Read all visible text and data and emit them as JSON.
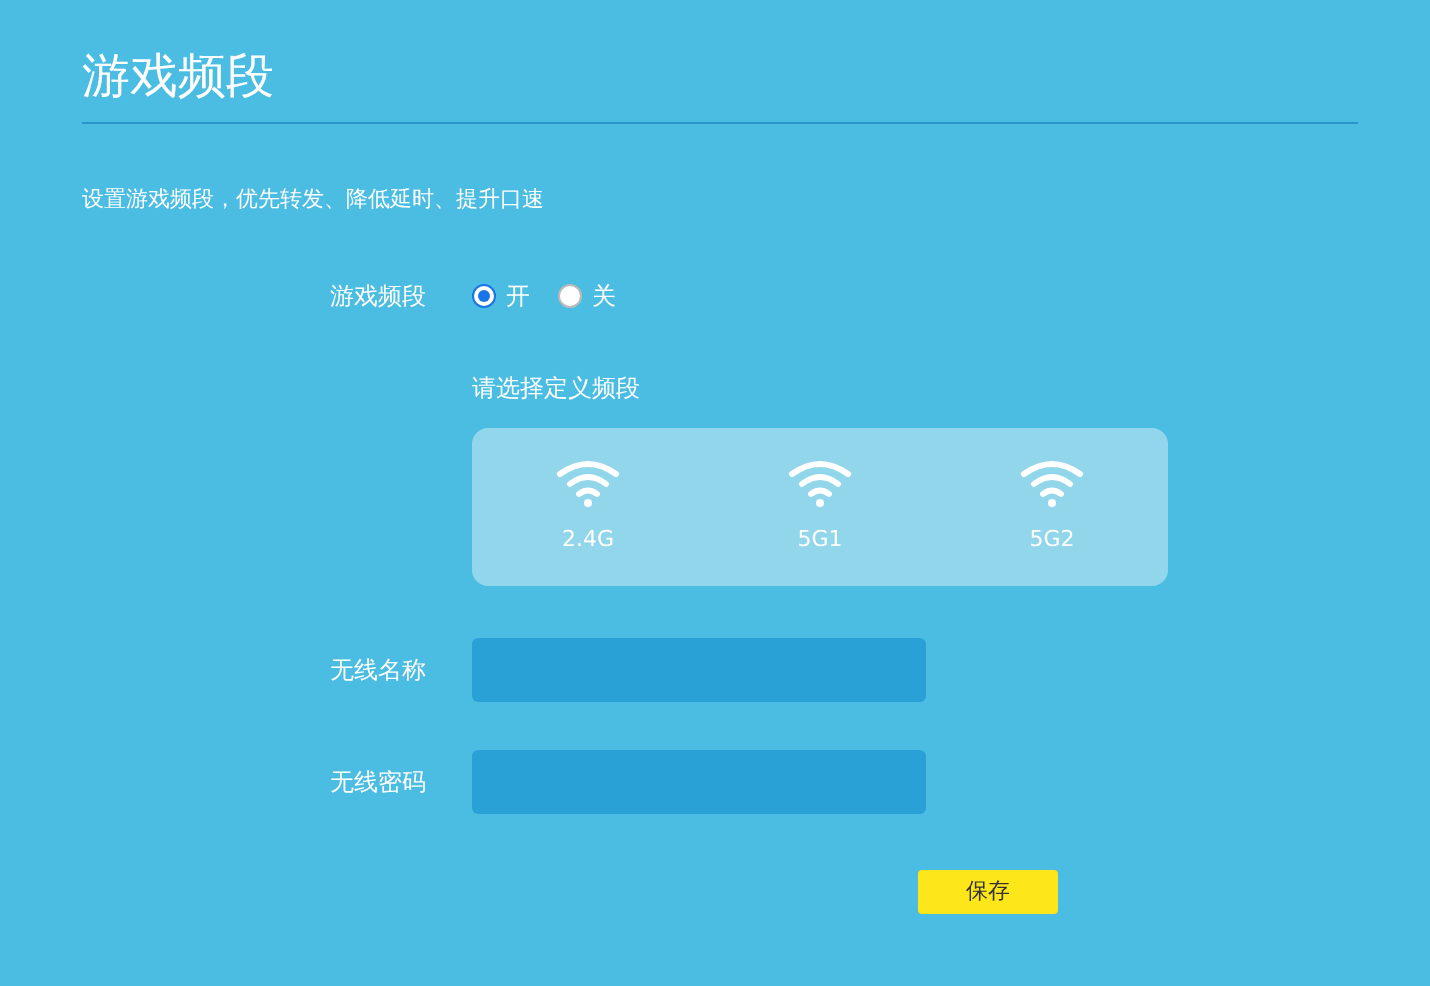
{
  "title": "游戏频段",
  "description": "设置游戏频段，优先转发、降低延时、提升口速",
  "toggle": {
    "label": "游戏频段",
    "options": [
      {
        "label": "开",
        "selected": true
      },
      {
        "label": "关",
        "selected": false
      }
    ]
  },
  "band_section": {
    "label": "请选择定义频段",
    "bands": [
      {
        "label": "2.4G"
      },
      {
        "label": "5G1"
      },
      {
        "label": "5G2"
      }
    ]
  },
  "fields": [
    {
      "label": "无线名称"
    },
    {
      "label": "无线密码"
    }
  ],
  "save_button": "保存"
}
